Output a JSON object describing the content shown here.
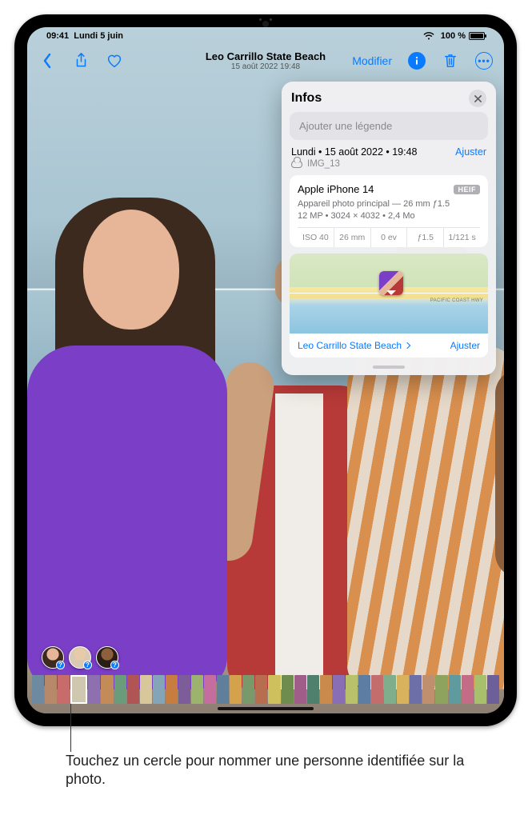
{
  "status": {
    "time": "09:41",
    "date": "Lundi 5 juin",
    "battery_pct": "100 %",
    "wifi_icon": "wifi-icon",
    "battery_icon": "battery-icon"
  },
  "navbar": {
    "back_icon": "chevron-left-icon",
    "share_icon": "share-icon",
    "favorite_icon": "heart-icon",
    "title": "Leo Carrillo State Beach",
    "subtitle": "15 août 2022  19:48",
    "modify": "Modifier",
    "info_icon": "info-icon",
    "trash_icon": "trash-icon",
    "more_icon": "ellipsis-icon"
  },
  "info_panel": {
    "title": "Infos",
    "close_icon": "close-icon",
    "caption_placeholder": "Ajouter une légende",
    "date_line": "Lundi • 15 août 2022 • 19:48",
    "date_adjust": "Ajuster",
    "filename": "IMG_13",
    "cloud_icon": "cloud-icon",
    "camera_model": "Apple iPhone 14",
    "format_badge": "HEIF",
    "lens_line": "Appareil photo principal — 26 mm ƒ1.5",
    "res_line": "12 MP • 3024 × 4032 • 2,4 Mo",
    "exif": {
      "iso": "ISO 40",
      "focal": "26 mm",
      "ev": "0 ev",
      "aperture": "ƒ1.5",
      "shutter": "1/121 s"
    },
    "map_hwy": "PACIFIC COAST HWY",
    "location_name": "Leo Carrillo State Beach",
    "location_adjust": "Ajuster"
  },
  "people": {
    "badge_glyph": "?"
  },
  "thumb_colors": [
    "#6e8aa0",
    "#b8886b",
    "#c76b6b",
    "#d0c7b0",
    "#8e6fb0",
    "#c28b57",
    "#6a9c7c",
    "#b05454",
    "#d8c79a",
    "#84a4b8",
    "#c77d3f",
    "#7d5c9a",
    "#9cb36d",
    "#c46d9e",
    "#5f7f9b",
    "#d4a24a",
    "#7a996b",
    "#b86d4e",
    "#cfc05e",
    "#6f8c4f",
    "#a05d8a",
    "#4f7f6d",
    "#c98a4c",
    "#8a6eb5",
    "#b9c26a",
    "#5e7da3",
    "#c46d6d",
    "#7fae8c",
    "#d9b25e",
    "#6d6fa8",
    "#c08f6d",
    "#8ea35e",
    "#5f9a9e",
    "#c46b88",
    "#a8c06b",
    "#6d5f9a"
  ],
  "thumb_selected_index": 3,
  "callout": "Touchez un cercle pour nommer une personne identifiée sur la photo."
}
